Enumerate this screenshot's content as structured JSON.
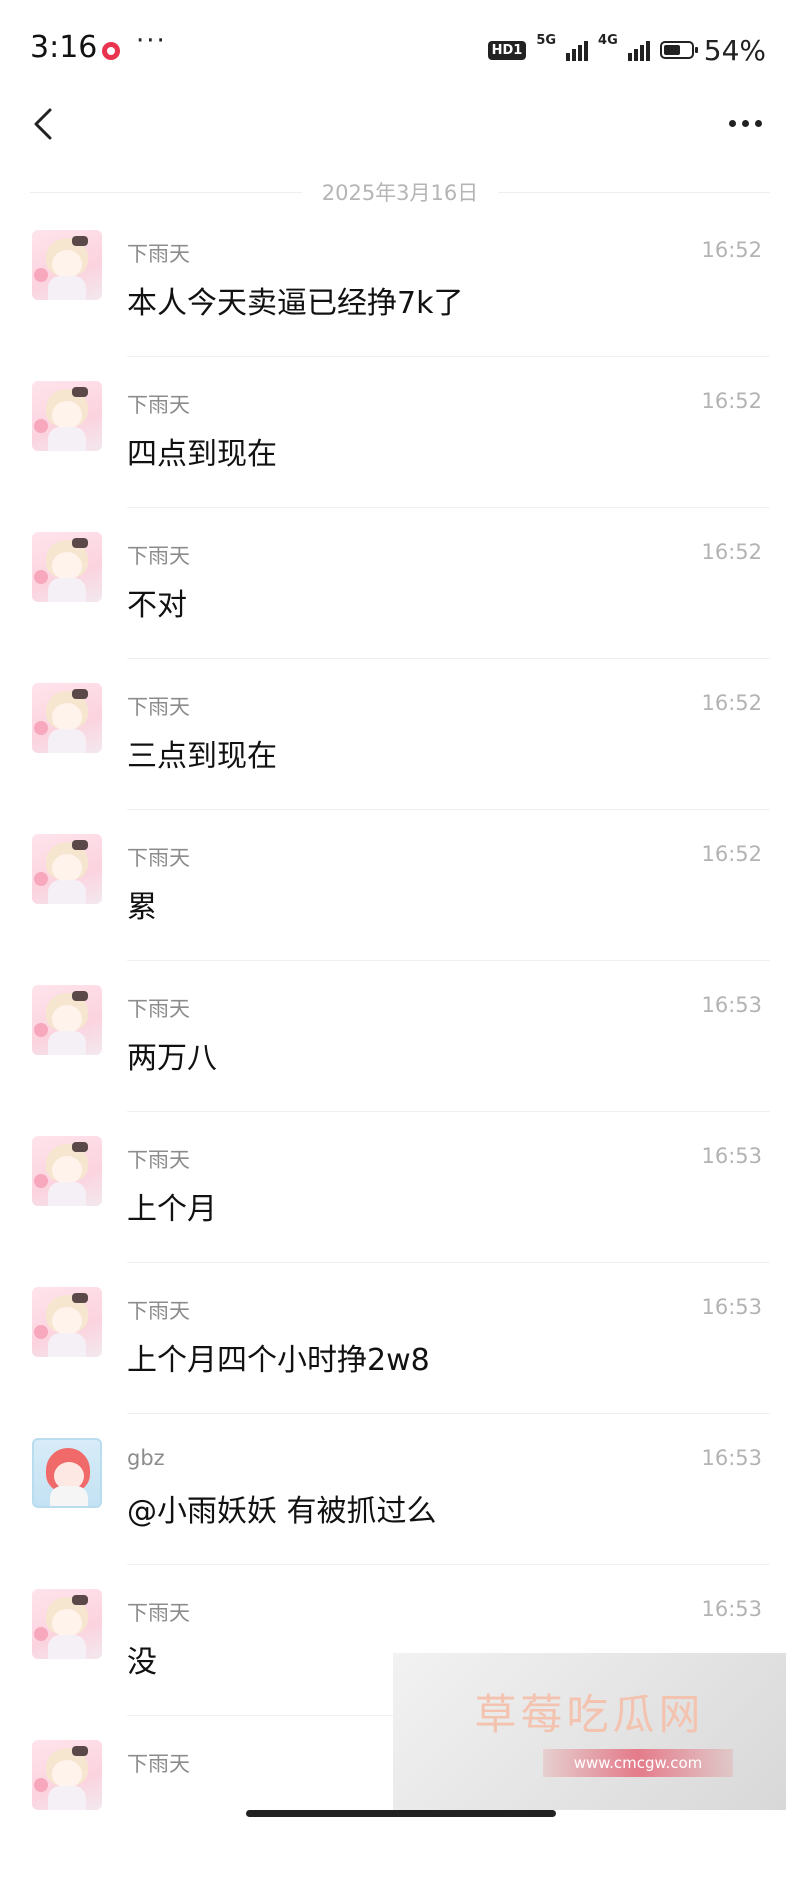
{
  "status_bar": {
    "time": "3:16",
    "dots": "···",
    "hd_badge": "HD1",
    "network_1": "5G",
    "network_2": "4G",
    "battery_percent": "54%"
  },
  "chat": {
    "date_divider": "2025年3月16日",
    "messages": [
      {
        "sender": "下雨天",
        "time": "16:52",
        "text": "本人今天卖逼已经挣7k了"
      },
      {
        "sender": "下雨天",
        "time": "16:52",
        "text": "四点到现在"
      },
      {
        "sender": "下雨天",
        "time": "16:52",
        "text": "不对"
      },
      {
        "sender": "下雨天",
        "time": "16:52",
        "text": "三点到现在"
      },
      {
        "sender": "下雨天",
        "time": "16:52",
        "text": "累"
      },
      {
        "sender": "下雨天",
        "time": "16:53",
        "text": "两万八"
      },
      {
        "sender": "下雨天",
        "time": "16:53",
        "text": "上个月"
      },
      {
        "sender": "下雨天",
        "time": "16:53",
        "text": "上个月四个小时挣2w8"
      },
      {
        "sender": "gbz",
        "time": "16:53",
        "text": "@小雨妖妖 有被抓过么"
      },
      {
        "sender": "下雨天",
        "time": "16:53",
        "text": "没"
      },
      {
        "sender": "下雨天",
        "time": "",
        "text": ""
      }
    ]
  },
  "watermark": {
    "title": "草莓吃瓜网",
    "url": "www.cmcgw.com"
  },
  "colors": {
    "notification": "#e8344e",
    "timestamp": "#b3b3b3",
    "sender": "#8c8c8c"
  }
}
